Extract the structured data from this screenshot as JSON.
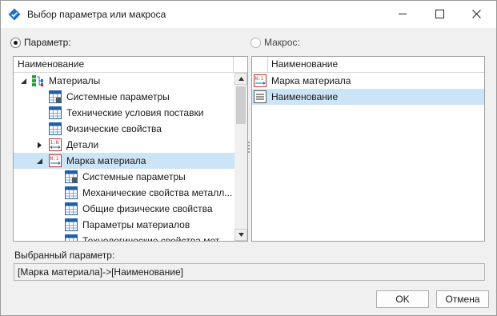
{
  "window": {
    "title": "Выбор параметра или макроса"
  },
  "radios": {
    "parameter_label": "Параметр:",
    "macro_label": "Макрос:",
    "parameter_selected": true
  },
  "left_panel": {
    "column_header": "Наименование",
    "rows": [
      {
        "label": "Материалы",
        "icon": "materials-tree-icon"
      },
      {
        "label": "Системные параметры",
        "icon": "lock-table-icon"
      },
      {
        "label": "Технические условия поставки",
        "icon": "table-icon"
      },
      {
        "label": "Физические свойства",
        "icon": "table-icon"
      },
      {
        "label": "Детали",
        "icon": "detail-icon"
      },
      {
        "label": "Марка материала",
        "icon": "grade-icon"
      },
      {
        "label": "Системные параметры",
        "icon": "lock-table-icon"
      },
      {
        "label": "Механические свойства металл...",
        "icon": "table-icon"
      },
      {
        "label": "Общие физические свойства",
        "icon": "table-icon"
      },
      {
        "label": "Параметры материалов",
        "icon": "table-icon"
      },
      {
        "label": "Технологические свойства мет...",
        "icon": "table-icon"
      }
    ]
  },
  "right_panel": {
    "column_header": "Наименование",
    "rows": [
      {
        "label": "Марка материала",
        "icon": "grade-icon"
      },
      {
        "label": "Наименование",
        "icon": "list-icon"
      }
    ]
  },
  "selected_parameter": {
    "label": "Выбранный параметр:",
    "value": "[Марка материала]->[Наименование]"
  },
  "buttons": {
    "ok": "OK",
    "cancel": "Отмена"
  },
  "colors": {
    "selection": "#cce4f7",
    "accent": "#1e73be"
  }
}
